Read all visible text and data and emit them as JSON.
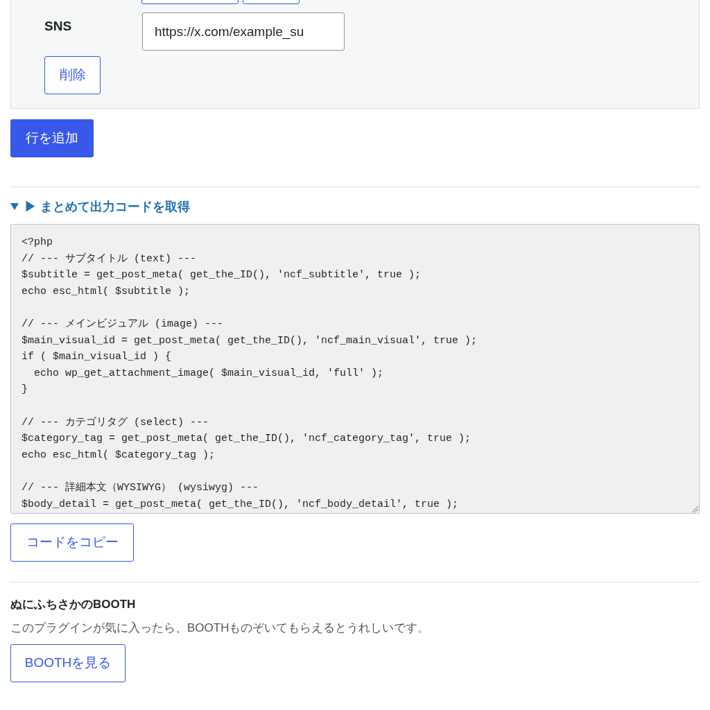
{
  "field_row": {
    "label": "SNS",
    "value": "https://x.com/example_su",
    "delete_button": "削除"
  },
  "add_row_button": "行を追加",
  "code_section": {
    "summary": "▶ まとめて出力コードを取得",
    "expanded": true,
    "code": "<?php\n// --- サブタイトル (text) ---\n$subtitle = get_post_meta( get_the_ID(), 'ncf_subtitle', true );\necho esc_html( $subtitle );\n\n// --- メインビジュアル (image) ---\n$main_visual_id = get_post_meta( get_the_ID(), 'ncf_main_visual', true );\nif ( $main_visual_id ) {\n  echo wp_get_attachment_image( $main_visual_id, 'full' );\n}\n\n// --- カテゴリタグ (select) ---\n$category_tag = get_post_meta( get_the_ID(), 'ncf_category_tag', true );\necho esc_html( $category_tag );\n\n// --- 詳細本文（WYSIWYG） (wysiwyg) ---\n$body_detail = get_post_meta( get_the_ID(), 'ncf_body_detail', true );",
    "copy_button": "コードをコピー"
  },
  "booth": {
    "title": "ぬにふちさかのBOOTH",
    "description": "このプラグインが気に入ったら、BOOTHものぞいてもらえるとうれしいです。",
    "button": "BOOTHを見る"
  }
}
